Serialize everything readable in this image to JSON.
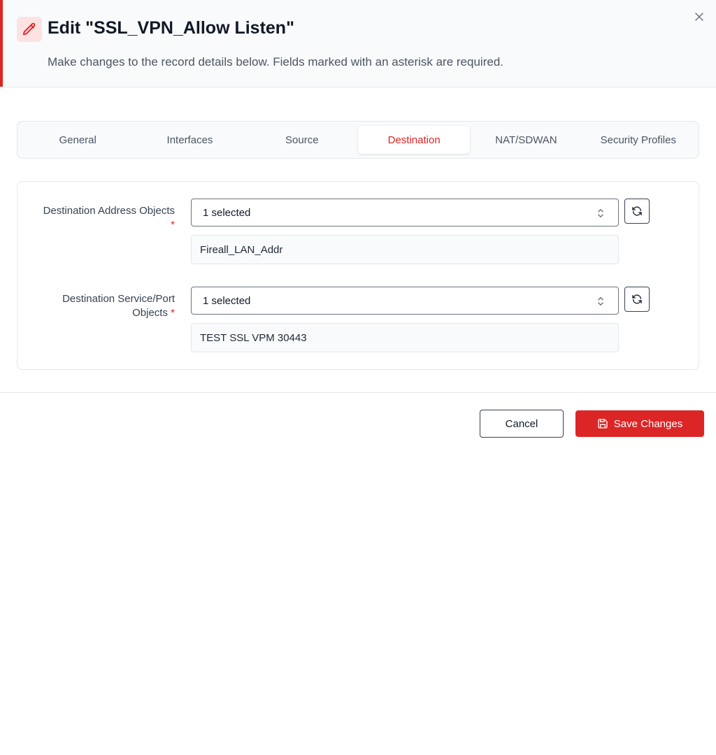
{
  "dialog": {
    "title": "Edit \"SSL_VPN_Allow Listen\"",
    "subtitle": "Make changes to the record details below. Fields marked with an asterisk are required.",
    "accent_color": "#dc2626"
  },
  "tabs": [
    {
      "label": "General"
    },
    {
      "label": "Interfaces"
    },
    {
      "label": "Source"
    },
    {
      "label": "Destination",
      "active": true
    },
    {
      "label": "NAT/SDWAN"
    },
    {
      "label": "Security Profiles"
    }
  ],
  "fields": {
    "dest_address": {
      "label": "Destination Address Objects",
      "required_mark": "*",
      "select_value": "1 selected",
      "selected_item": "Fireall_LAN_Addr"
    },
    "dest_service": {
      "label_line1": "Destination Service/Port",
      "label_line2": "Objects",
      "required_mark": "*",
      "select_value": "1 selected",
      "selected_item": "TEST SSL VPM 30443"
    }
  },
  "footer": {
    "cancel_label": "Cancel",
    "save_label": "Save Changes"
  },
  "icons": {
    "header": "pencil-icon",
    "close": "close-icon",
    "select": "chevron-up-down-icon",
    "refresh": "refresh-icon",
    "save": "save-icon"
  }
}
